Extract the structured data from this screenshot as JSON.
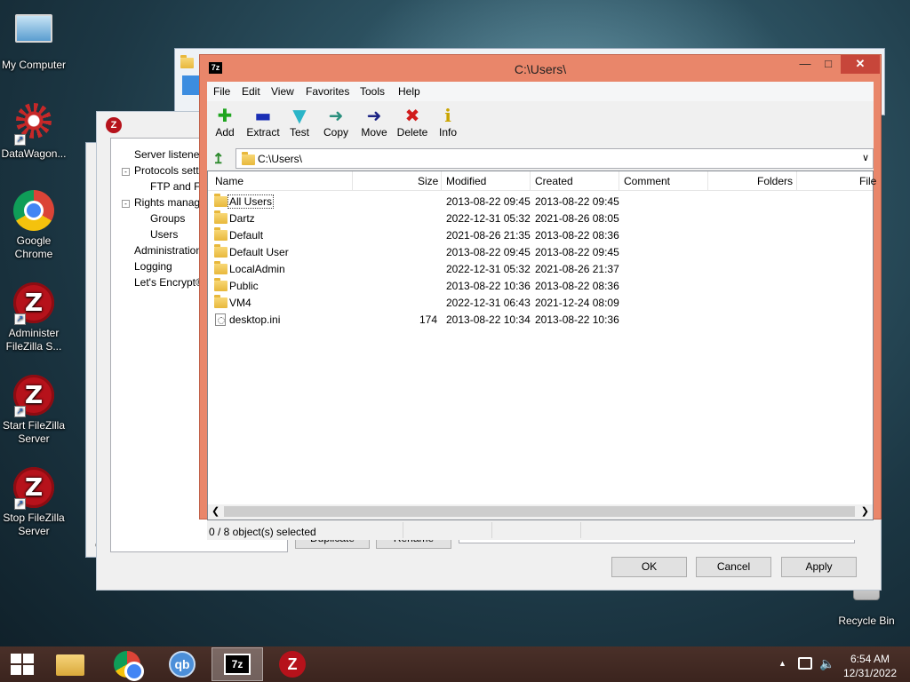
{
  "desktop": {
    "icons": [
      {
        "label": "My Computer"
      },
      {
        "label": "DataWagon..."
      },
      {
        "label": "Google Chrome"
      },
      {
        "label": "Administer FileZilla S..."
      },
      {
        "label": "Start FileZilla Server"
      },
      {
        "label": "Stop FileZilla Server"
      },
      {
        "label": "Recycle Bin"
      }
    ]
  },
  "filezilla_dialog": {
    "tree": [
      "Server listener",
      "Protocols setti",
      "FTP and FT",
      "Rights manag",
      "Groups",
      "Users",
      "Administration",
      "Logging",
      "Let's Encrypt®"
    ],
    "duplicate_label": "Duplicate",
    "rename_label": "Rename",
    "ok_label": "OK",
    "cancel_label": "Cancel",
    "apply_label": "Apply",
    "partial_c": "C"
  },
  "sevenzip": {
    "title": "C:\\Users\\",
    "app_icon": "7z",
    "menu": [
      "File",
      "Edit",
      "View",
      "Favorites",
      "Tools",
      "Help"
    ],
    "toolbar": [
      {
        "label": "Add",
        "icon": "plus-icon",
        "glyph": "✚",
        "color": "#1fa51f"
      },
      {
        "label": "Extract",
        "icon": "minus-icon",
        "glyph": "▬",
        "color": "#1b2fb5"
      },
      {
        "label": "Test",
        "icon": "check-icon",
        "glyph": "▼",
        "color": "#2bb5c8"
      },
      {
        "label": "Copy",
        "icon": "arrow-right-icon",
        "glyph": "➜",
        "color": "#2a8f7d"
      },
      {
        "label": "Move",
        "icon": "arrow-right-icon",
        "glyph": "➜",
        "color": "#1b2384"
      },
      {
        "label": "Delete",
        "icon": "x-icon",
        "glyph": "✖",
        "color": "#d11b1b"
      },
      {
        "label": "Info",
        "icon": "info-icon",
        "glyph": "i",
        "color": "#c9a400"
      }
    ],
    "address": "C:\\Users\\",
    "columns": [
      "Name",
      "Size",
      "Modified",
      "Created",
      "Comment",
      "Folders",
      "File"
    ],
    "rows": [
      {
        "name": "All Users",
        "size": "",
        "modified": "2013-08-22 09:45",
        "created": "2013-08-22 09:45",
        "type": "folder"
      },
      {
        "name": "Dartz",
        "size": "",
        "modified": "2022-12-31 05:32",
        "created": "2021-08-26 08:05",
        "type": "folder"
      },
      {
        "name": "Default",
        "size": "",
        "modified": "2021-08-26 21:35",
        "created": "2013-08-22 08:36",
        "type": "folder"
      },
      {
        "name": "Default User",
        "size": "",
        "modified": "2013-08-22 09:45",
        "created": "2013-08-22 09:45",
        "type": "folder"
      },
      {
        "name": "LocalAdmin",
        "size": "",
        "modified": "2022-12-31 05:32",
        "created": "2021-08-26 21:37",
        "type": "folder"
      },
      {
        "name": "Public",
        "size": "",
        "modified": "2013-08-22 10:36",
        "created": "2013-08-22 08:36",
        "type": "folder"
      },
      {
        "name": "VM4",
        "size": "",
        "modified": "2022-12-31 06:43",
        "created": "2021-12-24 08:09",
        "type": "folder"
      },
      {
        "name": "desktop.ini",
        "size": "174",
        "modified": "2013-08-22 10:34",
        "created": "2013-08-22 10:36",
        "type": "file"
      }
    ],
    "status": "0 / 8 object(s) selected"
  },
  "taskbar": {
    "time": "6:54 AM",
    "date": "12/31/2022",
    "tray_up": "▲",
    "apps": [
      "file-explorer",
      "google-chrome",
      "qbittorrent",
      "7-zip",
      "filezilla"
    ],
    "qb_text": "qb",
    "sevenzip_text": "7z",
    "fz_text": "Z"
  },
  "colors": {
    "sevenzip_frame": "#e9866a",
    "close_button": "#c7463a",
    "taskbar": "#3b241e"
  }
}
